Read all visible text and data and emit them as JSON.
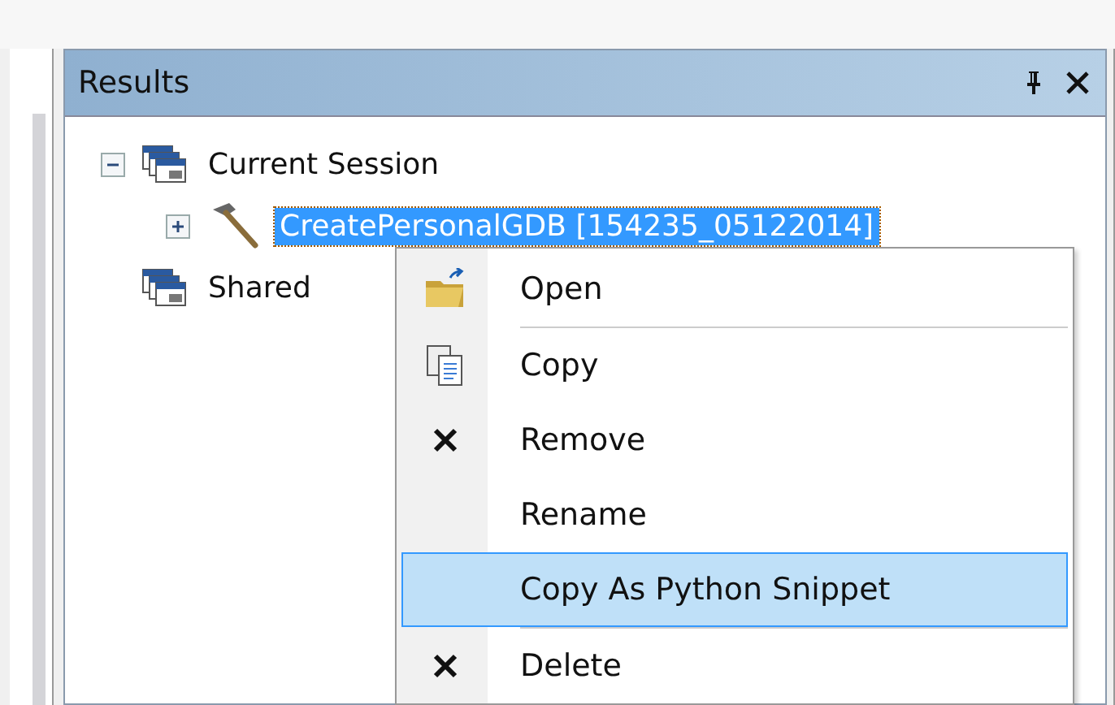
{
  "panel": {
    "title": "Results"
  },
  "tree": [
    {
      "label": "Current Session",
      "expanded": true,
      "selected": false,
      "children": [
        {
          "label": "CreatePersonalGDB [154235_05122014]",
          "expanded": false,
          "selected": true
        }
      ]
    },
    {
      "label": "Shared",
      "selected": false
    }
  ],
  "context_menu": [
    {
      "kind": "item",
      "label": "Open",
      "selected": false
    },
    {
      "kind": "separator"
    },
    {
      "kind": "item",
      "label": "Copy",
      "selected": false
    },
    {
      "kind": "item",
      "label": "Remove",
      "selected": false
    },
    {
      "kind": "item",
      "label": "Rename",
      "selected": false
    },
    {
      "kind": "item",
      "label": "Copy As Python Snippet",
      "selected": true
    },
    {
      "kind": "separator"
    },
    {
      "kind": "item",
      "label": "Delete",
      "selected": false
    }
  ]
}
